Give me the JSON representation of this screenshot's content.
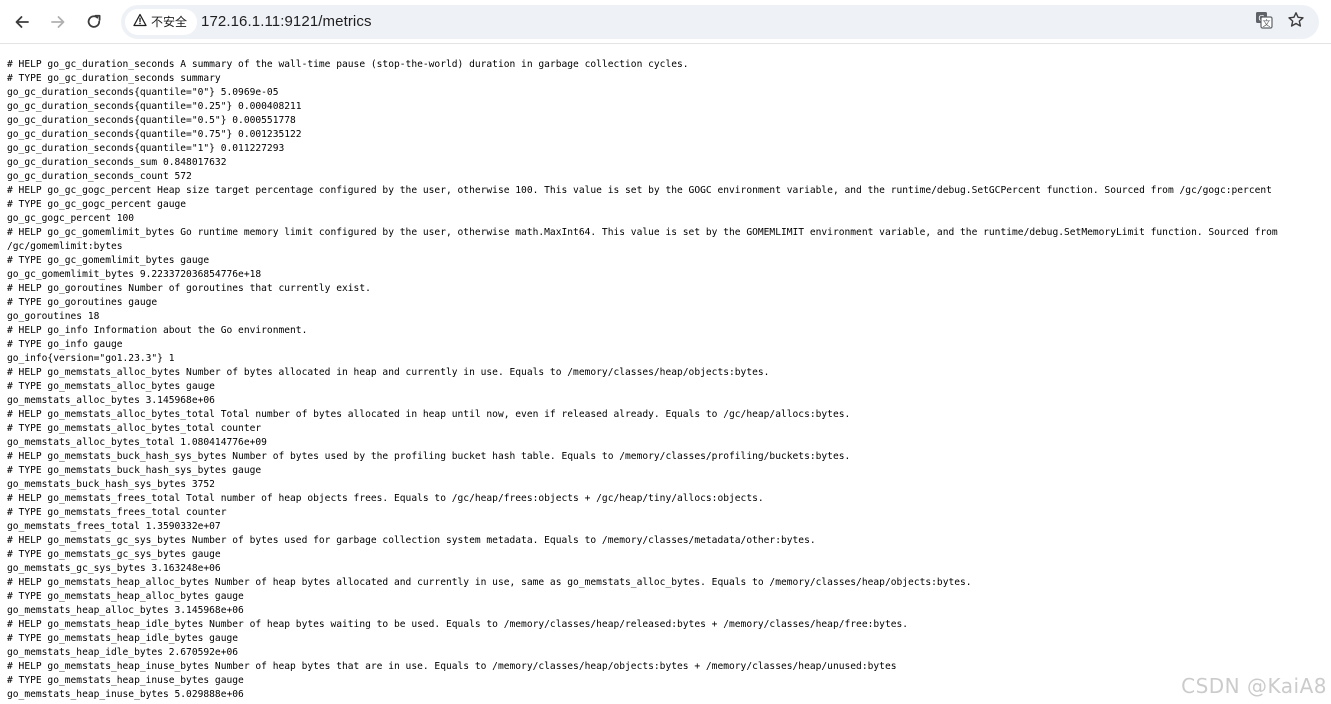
{
  "browser": {
    "security_label": "不安全",
    "url": "172.16.1.11:9121/metrics",
    "icons": {
      "back": "arrow-left-icon",
      "forward": "arrow-right-icon",
      "reload": "reload-icon",
      "warning": "warning-triangle-icon",
      "translate": "translate-icon",
      "bookmark": "star-icon"
    },
    "colors": {
      "toolbar_bg": "#ffffff",
      "omnibox_bg": "#eef1f6",
      "text": "#1f1f1f",
      "disabled_icon": "#b0b0b0"
    }
  },
  "metrics": {
    "lines": [
      "# HELP go_gc_duration_seconds A summary of the wall-time pause (stop-the-world) duration in garbage collection cycles.",
      "# TYPE go_gc_duration_seconds summary",
      "go_gc_duration_seconds{quantile=\"0\"} 5.0969e-05",
      "go_gc_duration_seconds{quantile=\"0.25\"} 0.000408211",
      "go_gc_duration_seconds{quantile=\"0.5\"} 0.000551778",
      "go_gc_duration_seconds{quantile=\"0.75\"} 0.001235122",
      "go_gc_duration_seconds{quantile=\"1\"} 0.011227293",
      "go_gc_duration_seconds_sum 0.848017632",
      "go_gc_duration_seconds_count 572",
      "# HELP go_gc_gogc_percent Heap size target percentage configured by the user, otherwise 100. This value is set by the GOGC environment variable, and the runtime/debug.SetGCPercent function. Sourced from /gc/gogc:percent",
      "# TYPE go_gc_gogc_percent gauge",
      "go_gc_gogc_percent 100",
      "# HELP go_gc_gomemlimit_bytes Go runtime memory limit configured by the user, otherwise math.MaxInt64. This value is set by the GOMEMLIMIT environment variable, and the runtime/debug.SetMemoryLimit function. Sourced from",
      "/gc/gomemlimit:bytes",
      "# TYPE go_gc_gomemlimit_bytes gauge",
      "go_gc_gomemlimit_bytes 9.223372036854776e+18",
      "# HELP go_goroutines Number of goroutines that currently exist.",
      "# TYPE go_goroutines gauge",
      "go_goroutines 18",
      "# HELP go_info Information about the Go environment.",
      "# TYPE go_info gauge",
      "go_info{version=\"go1.23.3\"} 1",
      "# HELP go_memstats_alloc_bytes Number of bytes allocated in heap and currently in use. Equals to /memory/classes/heap/objects:bytes.",
      "# TYPE go_memstats_alloc_bytes gauge",
      "go_memstats_alloc_bytes 3.145968e+06",
      "# HELP go_memstats_alloc_bytes_total Total number of bytes allocated in heap until now, even if released already. Equals to /gc/heap/allocs:bytes.",
      "# TYPE go_memstats_alloc_bytes_total counter",
      "go_memstats_alloc_bytes_total 1.080414776e+09",
      "# HELP go_memstats_buck_hash_sys_bytes Number of bytes used by the profiling bucket hash table. Equals to /memory/classes/profiling/buckets:bytes.",
      "# TYPE go_memstats_buck_hash_sys_bytes gauge",
      "go_memstats_buck_hash_sys_bytes 3752",
      "# HELP go_memstats_frees_total Total number of heap objects frees. Equals to /gc/heap/frees:objects + /gc/heap/tiny/allocs:objects.",
      "# TYPE go_memstats_frees_total counter",
      "go_memstats_frees_total 1.3590332e+07",
      "# HELP go_memstats_gc_sys_bytes Number of bytes used for garbage collection system metadata. Equals to /memory/classes/metadata/other:bytes.",
      "# TYPE go_memstats_gc_sys_bytes gauge",
      "go_memstats_gc_sys_bytes 3.163248e+06",
      "# HELP go_memstats_heap_alloc_bytes Number of heap bytes allocated and currently in use, same as go_memstats_alloc_bytes. Equals to /memory/classes/heap/objects:bytes.",
      "# TYPE go_memstats_heap_alloc_bytes gauge",
      "go_memstats_heap_alloc_bytes 3.145968e+06",
      "# HELP go_memstats_heap_idle_bytes Number of heap bytes waiting to be used. Equals to /memory/classes/heap/released:bytes + /memory/classes/heap/free:bytes.",
      "# TYPE go_memstats_heap_idle_bytes gauge",
      "go_memstats_heap_idle_bytes 2.670592e+06",
      "# HELP go_memstats_heap_inuse_bytes Number of heap bytes that are in use. Equals to /memory/classes/heap/objects:bytes + /memory/classes/heap/unused:bytes",
      "# TYPE go_memstats_heap_inuse_bytes gauge",
      "go_memstats_heap_inuse_bytes 5.029888e+06"
    ]
  },
  "watermark": "CSDN @KaiA8"
}
